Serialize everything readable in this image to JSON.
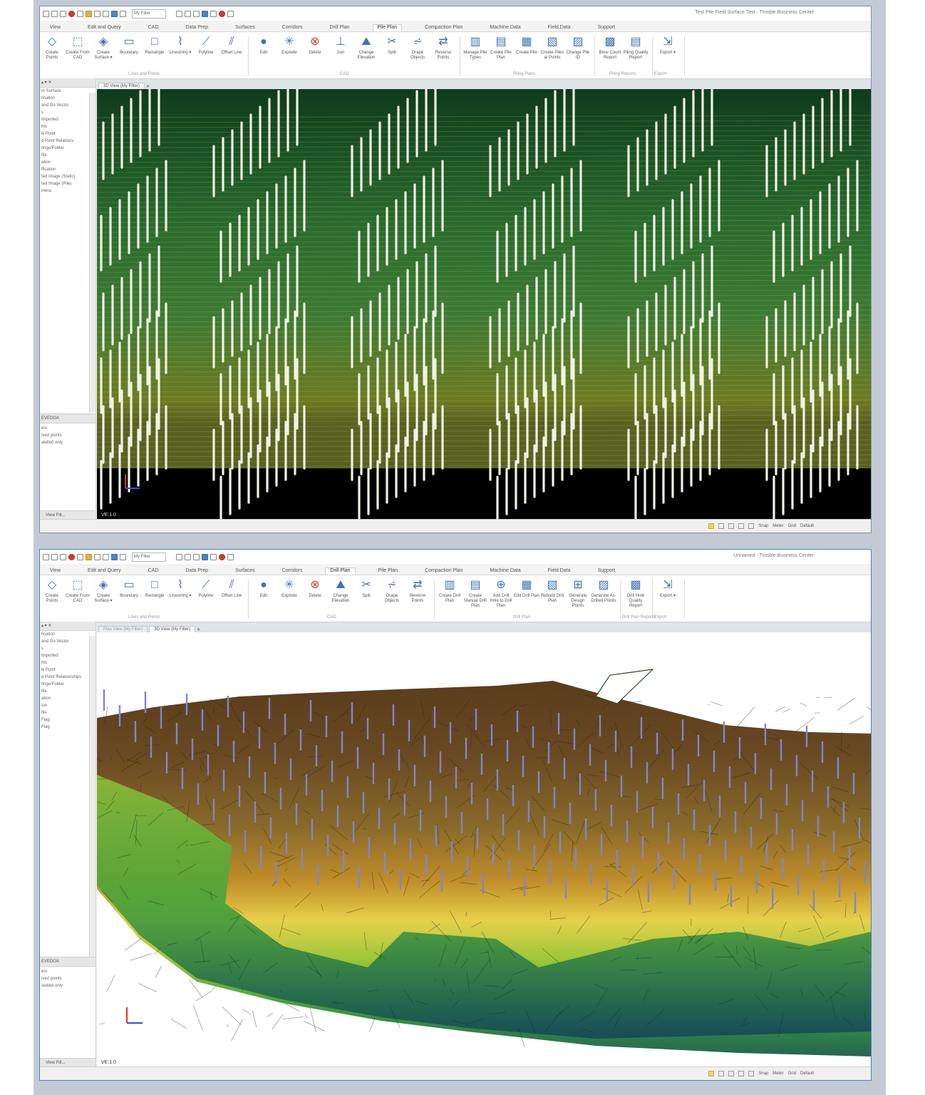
{
  "windows": [
    {
      "id": "pile",
      "title": "Test Pile Field Surface Test - Trimble Business Center",
      "filter": "My Filter",
      "tabs": [
        "View",
        "Edit and Query",
        "CAD",
        "Data Prep",
        "Surfaces",
        "Corridors",
        "Drill Plan",
        "Pile Plan",
        "Compaction Plan",
        "Machine Data",
        "Field Data",
        "Support"
      ],
      "active_tab": 7,
      "ribbon_groups": [
        {
          "label": "Lines and Points",
          "buttons": [
            {
              "icon": "create-points-icon",
              "glyph": "◇",
              "label": "Create Points"
            },
            {
              "icon": "create-from-cad-icon",
              "glyph": "⬚",
              "label": "Create From CAD"
            },
            {
              "icon": "create-surface-icon",
              "glyph": "◈",
              "label": "Create Surface ▾"
            },
            {
              "icon": "boundary-icon",
              "glyph": "▭",
              "label": "Boundary"
            },
            {
              "icon": "rectangle-icon",
              "glyph": "□",
              "label": "Rectangle"
            },
            {
              "icon": "linestring-icon",
              "glyph": "⌇",
              "label": "Linestring ▾"
            },
            {
              "icon": "polyline-icon",
              "glyph": "⟋",
              "label": "Polyline"
            },
            {
              "icon": "offset-line-icon",
              "glyph": "⫽",
              "label": "Offset Line"
            }
          ]
        },
        {
          "label": "CAD",
          "buttons": [
            {
              "icon": "edit-icon",
              "glyph": "●",
              "label": "Edit"
            },
            {
              "icon": "explode-icon",
              "glyph": "✳",
              "label": "Explode"
            },
            {
              "icon": "delete-icon",
              "glyph": "⊗",
              "label": "Delete",
              "red": true
            },
            {
              "icon": "join-icon",
              "glyph": "⊥",
              "label": "Join"
            },
            {
              "icon": "change-elevation-icon",
              "glyph": "⛰",
              "label": "Change Elevation"
            },
            {
              "icon": "split-icon",
              "glyph": "✂",
              "label": "Split"
            },
            {
              "icon": "drape-objects-icon",
              "glyph": "⩫",
              "label": "Drape Objects"
            },
            {
              "icon": "reverse-points-icon",
              "glyph": "⇄",
              "label": "Reverse Points"
            }
          ]
        },
        {
          "label": "Piling Plans",
          "buttons": [
            {
              "icon": "manage-pile-types-icon",
              "glyph": "▥",
              "label": "Manage Pile Types"
            },
            {
              "icon": "create-pile-plan-icon",
              "glyph": "▤",
              "label": "Create Pile Plan"
            },
            {
              "icon": "create-pile-icon",
              "glyph": "▦",
              "label": "Create Pile"
            },
            {
              "icon": "create-piles-at-points-icon",
              "glyph": "▧",
              "label": "Create Piles at Points"
            },
            {
              "icon": "change-pile-id-icon",
              "glyph": "▨",
              "label": "Change Pile ID"
            }
          ]
        },
        {
          "label": "Piling Reports",
          "buttons": [
            {
              "icon": "blow-count-report-icon",
              "glyph": "▩",
              "label": "Blow Count Report"
            },
            {
              "icon": "piling-quality-report-icon",
              "glyph": "▤",
              "label": "Piling Quality Report"
            }
          ]
        },
        {
          "label": "Export",
          "buttons": [
            {
              "icon": "export-icon",
              "glyph": "⇲",
              "label": "Export ▾"
            }
          ]
        }
      ],
      "left_panel": {
        "items": [
          "",
          "",
          "",
          "",
          "m Surface",
          "",
          "",
          "fication",
          "and Go Vector",
          "s",
          "Imported",
          "hts",
          "ik Point",
          "",
          "",
          "",
          "d Point Relations",
          "tinge/Folder",
          "",
          "file",
          "",
          "ation",
          "",
          "ification",
          "ted Image (Static)",
          "ted Image (Pile)",
          "mera"
        ],
        "section2": "EVEDOA",
        "section2_items": [
          "",
          "",
          "ers",
          "",
          "",
          "",
          "ived points",
          "alulled only"
        ],
        "bottom_tabs": [
          "",
          "View Filt..."
        ]
      },
      "doc_tabs": [
        "3D View (My Filter)"
      ],
      "ve": "VE:1.0",
      "status": [
        "Snap",
        "Meter",
        "Grid",
        "Default"
      ]
    },
    {
      "id": "drill",
      "title": "Unnamed - Trimble Business Center",
      "filter": "My Filter",
      "tabs": [
        "View",
        "Edit and Query",
        "CAD",
        "Data Prep",
        "Surfaces",
        "Corridors",
        "Drill Plan",
        "Pile Plan",
        "Compaction Plan",
        "Machine Data",
        "Field Data",
        "Support"
      ],
      "active_tab": 6,
      "ribbon_groups": [
        {
          "label": "Lines and Points",
          "buttons": [
            {
              "icon": "create-points-icon",
              "glyph": "◇",
              "label": "Create Points"
            },
            {
              "icon": "create-from-cad-icon",
              "glyph": "⬚",
              "label": "Create From CAD"
            },
            {
              "icon": "create-surface-icon",
              "glyph": "◈",
              "label": "Create Surface ▾"
            },
            {
              "icon": "boundary-icon",
              "glyph": "▭",
              "label": "Boundary"
            },
            {
              "icon": "rectangle-icon",
              "glyph": "□",
              "label": "Rectangle"
            },
            {
              "icon": "linestring-icon",
              "glyph": "⌇",
              "label": "Linestring ▾"
            },
            {
              "icon": "polyline-icon",
              "glyph": "⟋",
              "label": "Polyline"
            },
            {
              "icon": "offset-line-icon",
              "glyph": "⫽",
              "label": "Offset Line"
            }
          ]
        },
        {
          "label": "CAD",
          "buttons": [
            {
              "icon": "edit-icon",
              "glyph": "●",
              "label": "Edit"
            },
            {
              "icon": "explode-icon",
              "glyph": "✳",
              "label": "Explode"
            },
            {
              "icon": "delete-icon",
              "glyph": "⊗",
              "label": "Delete",
              "red": true
            },
            {
              "icon": "change-elevation-icon",
              "glyph": "⛰",
              "label": "Change Elevation"
            },
            {
              "icon": "split-icon",
              "glyph": "✂",
              "label": "Split"
            },
            {
              "icon": "drape-objects-icon",
              "glyph": "⩫",
              "label": "Drape Objects"
            },
            {
              "icon": "reverse-points-icon",
              "glyph": "⇄",
              "label": "Reverse Points"
            }
          ]
        },
        {
          "label": "Drill Plan",
          "buttons": [
            {
              "icon": "create-drill-plan-icon",
              "glyph": "▥",
              "label": "Create Drill Plan"
            },
            {
              "icon": "create-manual-drill-plan-icon",
              "glyph": "▤",
              "label": "Create Manual Drill Plan"
            },
            {
              "icon": "add-drill-hole-icon",
              "glyph": "⊕",
              "label": "Add Drill Hole to Drill Plan"
            },
            {
              "icon": "edit-drill-plan-icon",
              "glyph": "▦",
              "label": "Edit Drill Plan"
            },
            {
              "icon": "rebuild-drill-plan-icon",
              "glyph": "▧",
              "label": "Rebuild Drill Plan"
            },
            {
              "icon": "generate-design-points-icon",
              "glyph": "⊞",
              "label": "Generate Design Points"
            },
            {
              "icon": "generate-as-drilled-points-icon",
              "glyph": "▨",
              "label": "Generate As-Drilled Points"
            }
          ]
        },
        {
          "label": "Drill Plan Reports",
          "buttons": [
            {
              "icon": "drill-hole-quality-report-icon",
              "glyph": "▩",
              "label": "Drill Hole Quality Report"
            }
          ]
        },
        {
          "label": "Export",
          "buttons": [
            {
              "icon": "export-icon",
              "glyph": "⇲",
              "label": "Export ▾"
            }
          ]
        }
      ],
      "left_panel": {
        "items": [
          "",
          "",
          "",
          "",
          "",
          "",
          "",
          "fication",
          "and Go Vector",
          "s",
          "Imported",
          "hts",
          "ik Point",
          "",
          "",
          "",
          "d Point Relationships",
          "tinge/Folder",
          "",
          "file",
          "",
          "ation",
          "",
          "",
          "ion",
          "file",
          "Flag",
          "Flag"
        ],
        "section2": "EVEDOA",
        "section2_items": [
          "",
          "",
          "ers",
          "",
          "",
          "",
          "ived points",
          "alulled only"
        ],
        "bottom_tabs": [
          "",
          "View Filt..."
        ]
      },
      "doc_tabs": [
        "Plan View (My Filter)",
        "3D View (My Filter)"
      ],
      "ve": "VE:1.0",
      "status": [
        "Snap",
        "Meter",
        "Grid",
        "Default"
      ]
    }
  ],
  "colors": {
    "pile_bg_top": "#0f3b1d",
    "pile_bg_mid": "#3f7a34",
    "pile_bg_low": "#6f7a22",
    "pile_color": "#eef3e2",
    "drill_hole_color": "#8484c8",
    "accent": "#4a7fc1"
  }
}
